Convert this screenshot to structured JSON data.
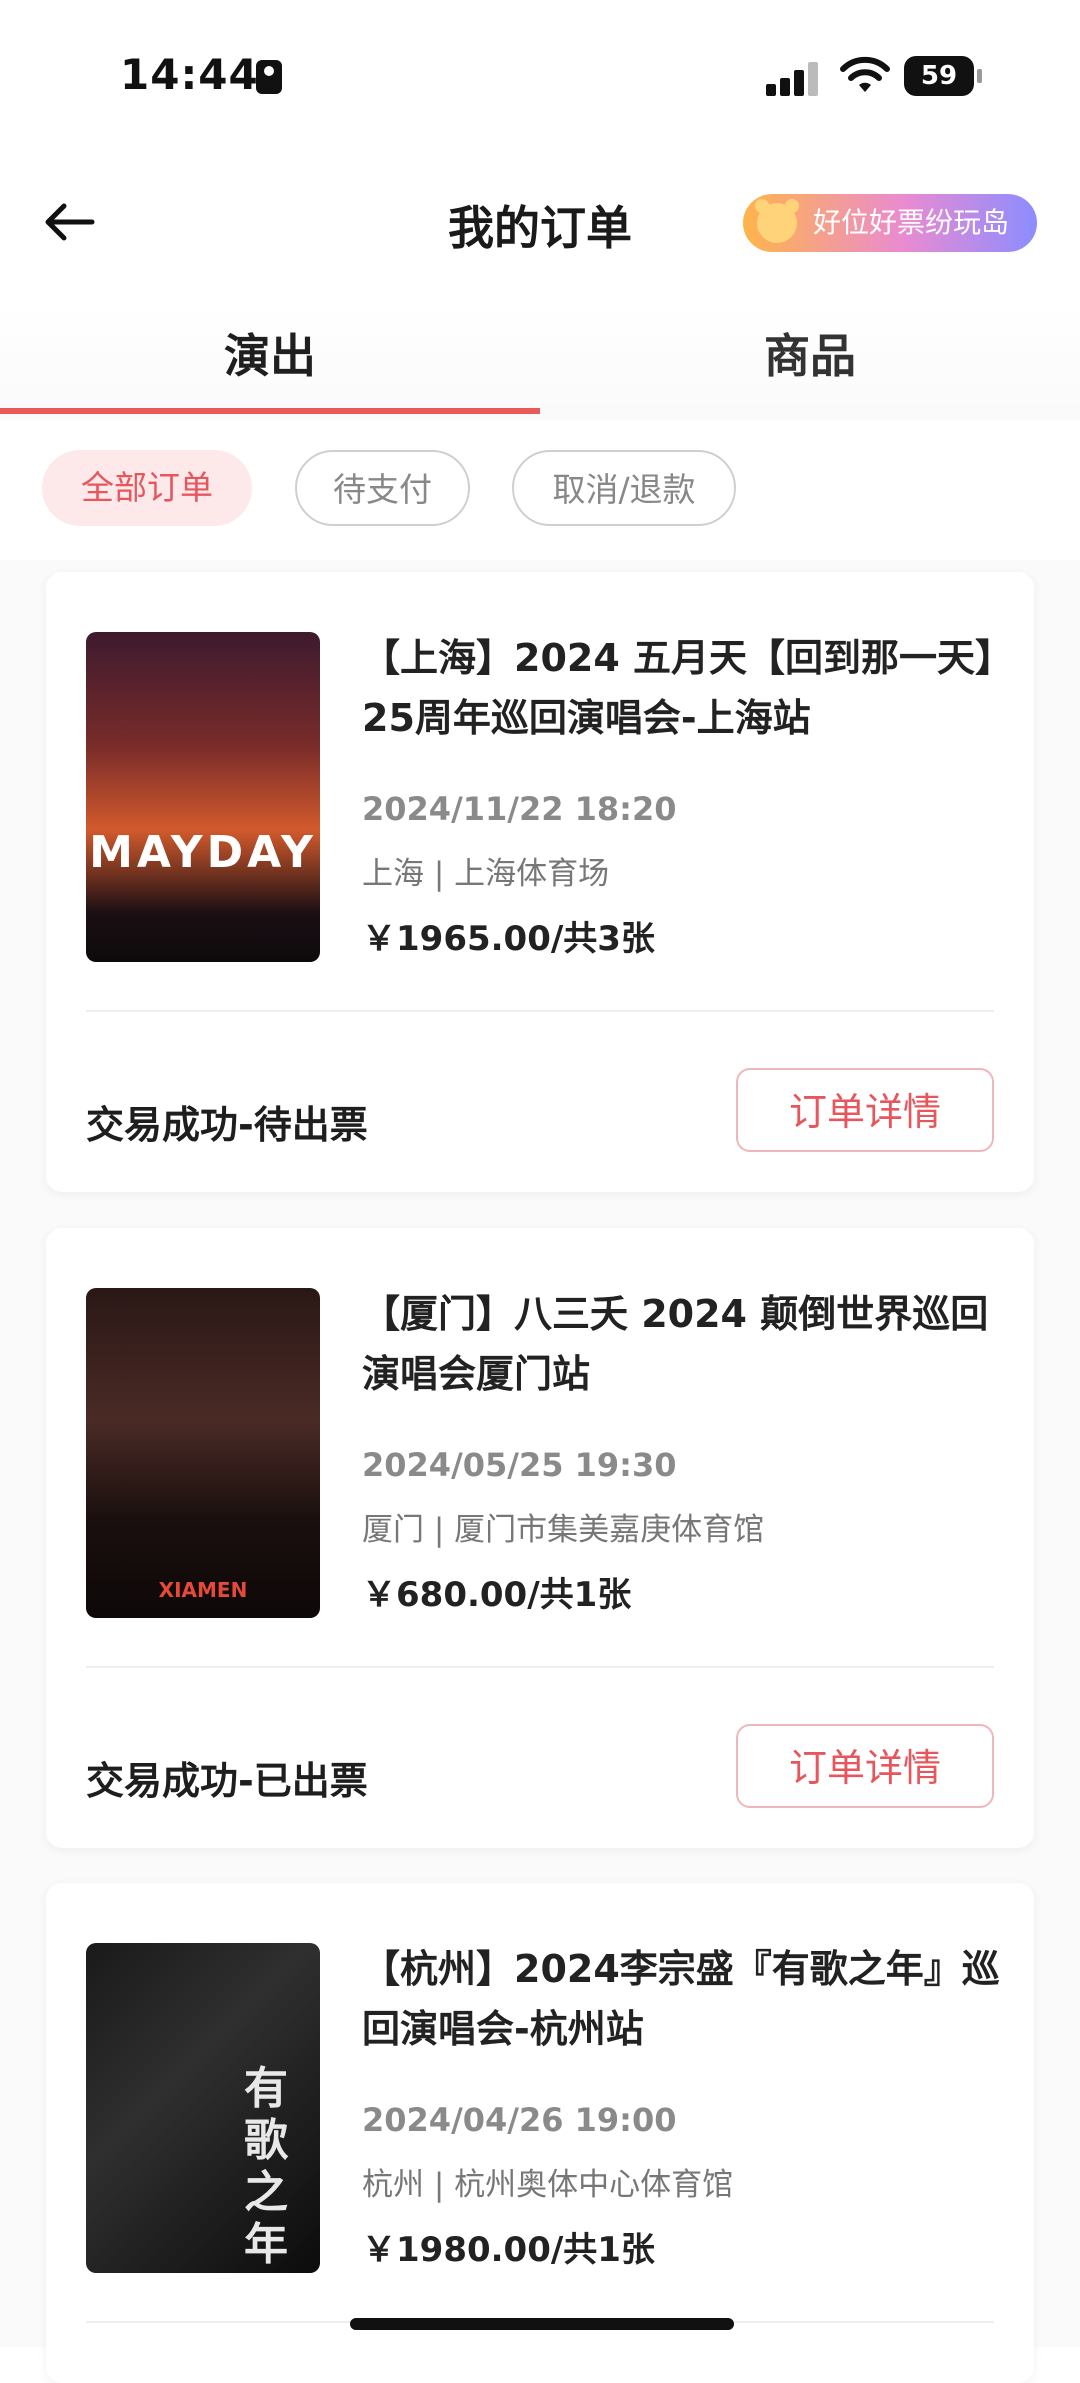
{
  "status_bar": {
    "time": "14:44",
    "battery": "59"
  },
  "nav": {
    "title": "我的订单",
    "promo": "好位好票纷玩岛"
  },
  "tabs": [
    {
      "label": "演出"
    },
    {
      "label": "商品"
    }
  ],
  "filters": [
    {
      "label": "全部订单"
    },
    {
      "label": "待支付"
    },
    {
      "label": "取消/退款"
    }
  ],
  "orders": [
    {
      "title": "【上海】2024 五月天【回到那一天】25周年巡回演唱会-上海站",
      "datetime": "2024/11/22 18:20",
      "venue": "上海 | 上海体育场",
      "price": "￥1965.00/共3张",
      "status": "交易成功-待出票",
      "button": "订单详情",
      "poster_text": "MAYDAY"
    },
    {
      "title": "【厦门】八三夭 2024 颠倒世界巡回演唱会厦门站",
      "datetime": "2024/05/25 19:30",
      "venue": "厦门 | 厦门市集美嘉庚体育馆",
      "price": "￥680.00/共1张",
      "status": "交易成功-已出票",
      "button": "订单详情",
      "poster_text": "XIAMEN"
    },
    {
      "title": "【杭州】2024李宗盛『有歌之年』巡回演唱会-杭州站",
      "datetime": "2024/04/26 19:00",
      "venue": "杭州 | 杭州奥体中心体育馆",
      "price": "￥1980.00/共1张",
      "status": "",
      "button": "",
      "poster_text": "有歌之年"
    }
  ]
}
